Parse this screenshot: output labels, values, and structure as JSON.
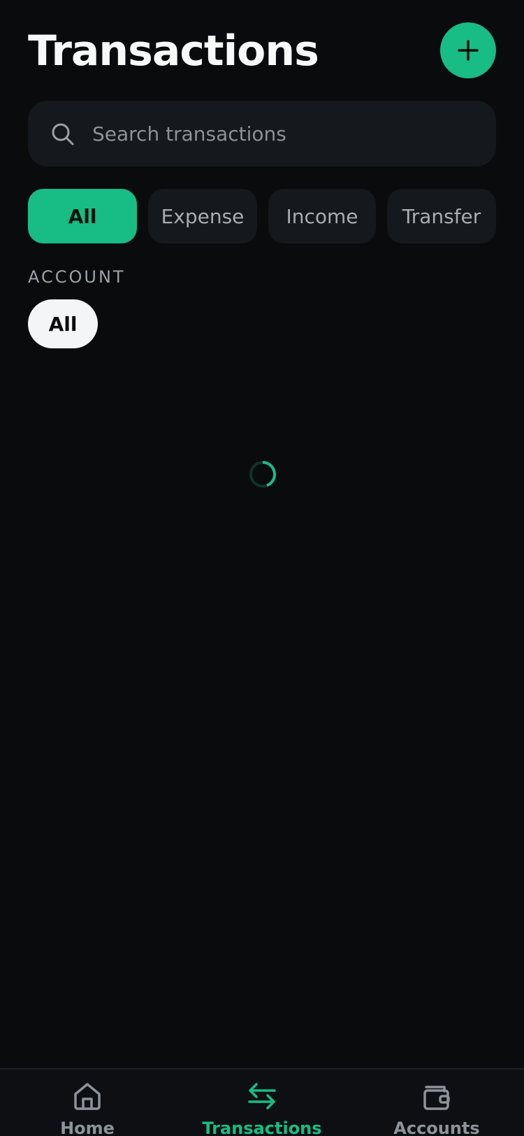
{
  "header": {
    "title": "Transactions",
    "add_icon": "plus-icon"
  },
  "search": {
    "placeholder": "Search transactions",
    "value": "",
    "icon": "search-icon"
  },
  "type_filters": [
    {
      "label": "All",
      "active": true
    },
    {
      "label": "Expense",
      "active": false
    },
    {
      "label": "Income",
      "active": false
    },
    {
      "label": "Transfer",
      "active": false
    }
  ],
  "account": {
    "section_label": "ACCOUNT",
    "selected": "All"
  },
  "loading": {
    "indicator": "spinner",
    "progress": 0.25
  },
  "bottom_nav": {
    "active": "Transactions",
    "items": [
      {
        "label": "Home",
        "icon": "home-icon"
      },
      {
        "label": "Transactions",
        "icon": "transfer-arrows-icon"
      },
      {
        "label": "Accounts",
        "icon": "wallet-icon"
      }
    ]
  },
  "colors": {
    "background": "#0a0b0d",
    "surface": "#15181c",
    "accent": "#17bd84",
    "text_primary": "#f7f8f8",
    "text_muted": "#8d9298"
  }
}
